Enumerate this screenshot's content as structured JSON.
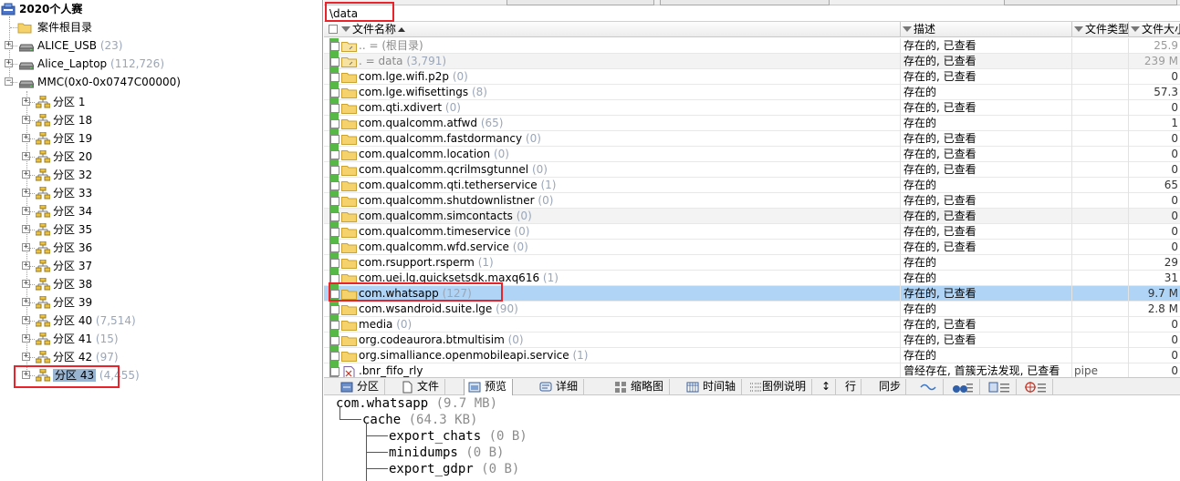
{
  "tree": {
    "root": {
      "label": "2020个人赛"
    },
    "items": [
      {
        "label": "案件根目录",
        "count": "",
        "icon": "folder-icon",
        "level": 1
      },
      {
        "label": "ALICE_USB",
        "count": "(23)",
        "icon": "drive-icon",
        "level": 1
      },
      {
        "label": "Alice_Laptop",
        "count": "(112,726)",
        "icon": "drive-icon",
        "level": 1
      },
      {
        "label": "MMC(0x0-0x0747C00000)",
        "count": "",
        "icon": "drive-icon",
        "level": 1
      }
    ],
    "partitions": [
      {
        "label": "分区 1",
        "count": ""
      },
      {
        "label": "分区 18",
        "count": ""
      },
      {
        "label": "分区 19",
        "count": ""
      },
      {
        "label": "分区 20",
        "count": ""
      },
      {
        "label": "分区 32",
        "count": ""
      },
      {
        "label": "分区 33",
        "count": ""
      },
      {
        "label": "分区 34",
        "count": ""
      },
      {
        "label": "分区 35",
        "count": ""
      },
      {
        "label": "分区 36",
        "count": ""
      },
      {
        "label": "分区 37",
        "count": ""
      },
      {
        "label": "分区 38",
        "count": ""
      },
      {
        "label": "分区 39",
        "count": ""
      },
      {
        "label": "分区 40",
        "count": "(7,514)"
      },
      {
        "label": "分区 41",
        "count": "(15)"
      },
      {
        "label": "分区 42",
        "count": "(97)"
      },
      {
        "label": "分区 43",
        "count": "(4,455)"
      }
    ],
    "selected_partition": "分区 43"
  },
  "path": {
    "text": "\\data"
  },
  "columns": {
    "name": "文件名称",
    "desc": "描述",
    "type": "文件类型",
    "size": "文件大小"
  },
  "rows": [
    {
      "name": ".. = (根目录)",
      "count": "",
      "desc": "存在的, 已查看",
      "type": "",
      "size": "25.9",
      "muted": true
    },
    {
      "name": ". = data",
      "count": "(3,791)",
      "desc": "存在的, 已查看",
      "type": "",
      "size": "239 M",
      "muted": true
    },
    {
      "name": "com.lge.wifi.p2p",
      "count": "(0)",
      "desc": "存在的, 已查看",
      "type": "",
      "size": "0"
    },
    {
      "name": "com.lge.wifisettings",
      "count": "(8)",
      "desc": "存在的",
      "type": "",
      "size": "57.3"
    },
    {
      "name": "com.qti.xdivert",
      "count": "(0)",
      "desc": "存在的, 已查看",
      "type": "",
      "size": "0"
    },
    {
      "name": "com.qualcomm.atfwd",
      "count": "(65)",
      "desc": "存在的",
      "type": "",
      "size": "1"
    },
    {
      "name": "com.qualcomm.fastdormancy",
      "count": "(0)",
      "desc": "存在的, 已查看",
      "type": "",
      "size": "0"
    },
    {
      "name": "com.qualcomm.location",
      "count": "(0)",
      "desc": "存在的, 已查看",
      "type": "",
      "size": "0"
    },
    {
      "name": "com.qualcomm.qcrilmsgtunnel",
      "count": "(0)",
      "desc": "存在的, 已查看",
      "type": "",
      "size": "0"
    },
    {
      "name": "com.qualcomm.qti.tetherservice",
      "count": "(1)",
      "desc": "存在的",
      "type": "",
      "size": "65"
    },
    {
      "name": "com.qualcomm.shutdownlistner",
      "count": "(0)",
      "desc": "存在的, 已查看",
      "type": "",
      "size": "0"
    },
    {
      "name": "com.qualcomm.simcontacts",
      "count": "(0)",
      "desc": "存在的, 已查看",
      "type": "",
      "size": "0"
    },
    {
      "name": "com.qualcomm.timeservice",
      "count": "(0)",
      "desc": "存在的, 已查看",
      "type": "",
      "size": "0"
    },
    {
      "name": "com.qualcomm.wfd.service",
      "count": "(0)",
      "desc": "存在的, 已查看",
      "type": "",
      "size": "0"
    },
    {
      "name": "com.rsupport.rsperm",
      "count": "(1)",
      "desc": "存在的",
      "type": "",
      "size": "29"
    },
    {
      "name": "com.uei.lg.quicksetsdk.maxq616",
      "count": "(1)",
      "desc": "存在的",
      "type": "",
      "size": "31"
    },
    {
      "name": "com.whatsapp",
      "count": "(127)",
      "desc": "存在的, 已查看",
      "type": "",
      "size": "9.7 M",
      "selected": true
    },
    {
      "name": "com.wsandroid.suite.lge",
      "count": "(90)",
      "desc": "存在的",
      "type": "",
      "size": "2.8 M"
    },
    {
      "name": "media",
      "count": "(0)",
      "desc": "存在的, 已查看",
      "type": "",
      "size": "0"
    },
    {
      "name": "org.codeaurora.btmultisim",
      "count": "(0)",
      "desc": "存在的, 已查看",
      "type": "",
      "size": "0"
    },
    {
      "name": "org.simalliance.openmobileapi.service",
      "count": "(1)",
      "desc": "存在的",
      "type": "",
      "size": "0"
    },
    {
      "name": ".bnr_fifo_rly",
      "count": "",
      "desc": "曾经存在, 首簇无法发现, 已查看",
      "type": "pipe",
      "size": "0",
      "file": true
    }
  ],
  "toolbar": {
    "partition": "分区",
    "file": "文件",
    "preview": "预览",
    "detail": "详细",
    "thumb": "缩略图",
    "timeline": "时间轴",
    "legend": "图例说明",
    "line": "行",
    "sync": "同步"
  },
  "preview": [
    {
      "indent": 0,
      "name": "com.whatsapp",
      "count": "(9.7 MB)"
    },
    {
      "indent": 1,
      "name": "cache",
      "count": "(64.3 KB)"
    },
    {
      "indent": 2,
      "name": "export_chats",
      "count": "(0 B)"
    },
    {
      "indent": 2,
      "name": "minidumps",
      "count": "(0 B)"
    },
    {
      "indent": 2,
      "name": "export_gdpr",
      "count": "(0 B)"
    }
  ],
  "colors": {
    "selection": "#b0d4f5",
    "annotation": "#e8242a",
    "folder": "#f5d26b"
  }
}
